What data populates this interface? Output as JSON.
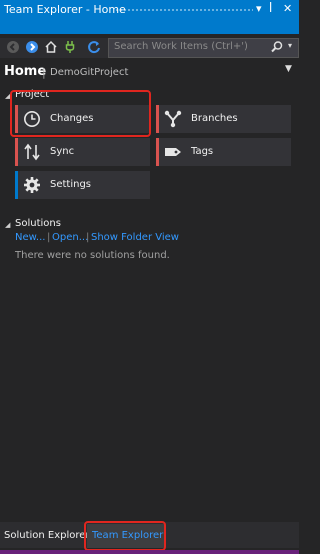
{
  "window": {
    "title": "Team Explorer - Home",
    "pin_glyph": "▾ ⊥ ✕"
  },
  "toolbar": {
    "back_icon": "back-icon",
    "forward_icon": "forward-icon",
    "home_icon": "home-icon",
    "connect_icon": "connect-icon",
    "refresh_icon": "refresh-icon"
  },
  "search": {
    "placeholder": "Search Work Items (Ctrl+')"
  },
  "home": {
    "title": "Home",
    "separator": "|",
    "project": "DemoGitProject"
  },
  "project_section": {
    "label": "Project",
    "tiles": [
      {
        "label": "Changes",
        "icon": "clock-icon",
        "accent": "#d9534f"
      },
      {
        "label": "Branches",
        "icon": "branch-icon",
        "accent": "#d9534f"
      },
      {
        "label": "Sync",
        "icon": "sync-icon",
        "accent": "#d9534f"
      },
      {
        "label": "Tags",
        "icon": "tag-icon",
        "accent": "#d9534f"
      },
      {
        "label": "Settings",
        "icon": "gear-icon",
        "accent": "#007acc"
      }
    ]
  },
  "solutions_section": {
    "label": "Solutions",
    "links": {
      "new": "New...",
      "open": "Open...",
      "show_folder": "Show Folder View"
    },
    "separator": "|",
    "empty_message": "There were no solutions found."
  },
  "bottom_tabs": {
    "solution_explorer": "Solution Explorer",
    "team_explorer": "Team Explorer"
  },
  "colors": {
    "accent_blue": "#007acc",
    "highlight_red": "#e0261f",
    "purple_status": "#68217a"
  }
}
